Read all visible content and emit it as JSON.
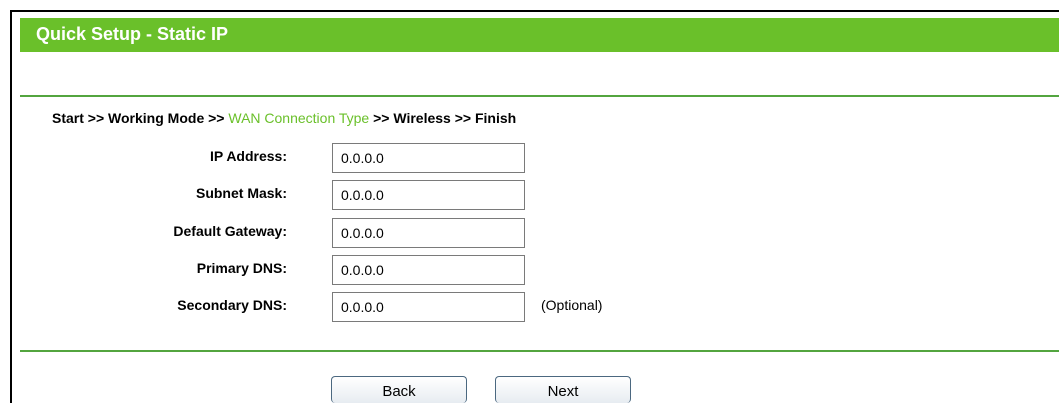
{
  "header": {
    "title": "Quick Setup - Static IP"
  },
  "breadcrumb": {
    "steps": [
      "Start",
      "Working Mode",
      "WAN Connection Type",
      "Wireless",
      "Finish"
    ],
    "separator": ">>",
    "current_step": "WAN Connection Type",
    "current_color": "#6ac02a"
  },
  "form": {
    "fields": [
      {
        "label": "IP Address:",
        "value": "0.0.0.0"
      },
      {
        "label": "Subnet Mask:",
        "value": "0.0.0.0"
      },
      {
        "label": "Default Gateway:",
        "value": "0.0.0.0"
      },
      {
        "label": "Primary DNS:",
        "value": "0.0.0.0"
      },
      {
        "label": "Secondary DNS:",
        "value": "0.0.0.0",
        "note": "(Optional)"
      }
    ]
  },
  "buttons": {
    "back_label": "Back",
    "next_label": "Next"
  },
  "colors": {
    "title_bar": "#6ac02a",
    "divider": "#53a53f"
  }
}
